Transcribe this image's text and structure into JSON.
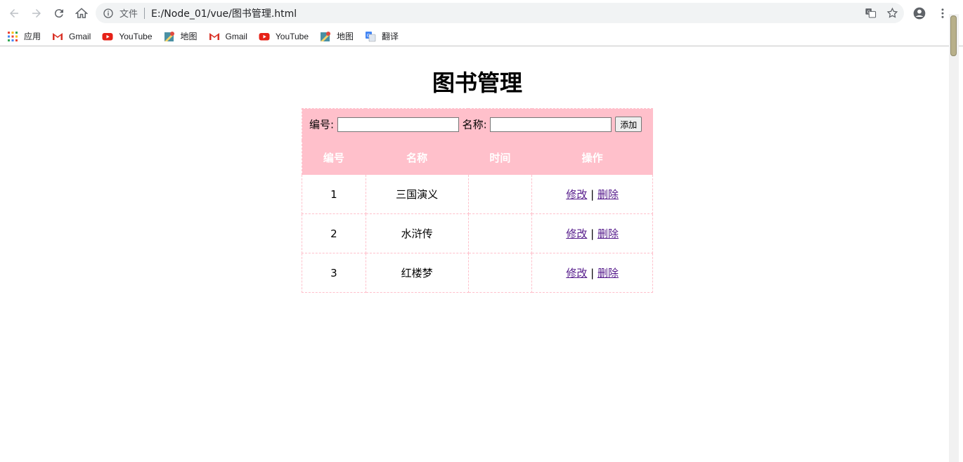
{
  "browser": {
    "scheme_label": "文件",
    "url": "E:/Node_01/vue/图书管理.html",
    "bookmarks": [
      {
        "label": "应用",
        "icon": "apps-grid-icon"
      },
      {
        "label": "Gmail",
        "icon": "gmail-icon"
      },
      {
        "label": "YouTube",
        "icon": "youtube-icon"
      },
      {
        "label": "地图",
        "icon": "maps-icon"
      },
      {
        "label": "Gmail",
        "icon": "gmail-icon"
      },
      {
        "label": "YouTube",
        "icon": "youtube-icon"
      },
      {
        "label": "地图",
        "icon": "maps-icon"
      },
      {
        "label": "翻译",
        "icon": "translate-icon"
      }
    ]
  },
  "page": {
    "title": "图书管理",
    "form": {
      "id_label": "编号:",
      "id_value": "",
      "name_label": "名称:",
      "name_value": "",
      "add_button": "添加"
    },
    "table": {
      "headers": [
        "编号",
        "名称",
        "时间",
        "操作"
      ],
      "rows": [
        {
          "id": "1",
          "name": "三国演义",
          "time": "",
          "edit": "修改",
          "sep": "|",
          "delete": "删除"
        },
        {
          "id": "2",
          "name": "水浒传",
          "time": "",
          "edit": "修改",
          "sep": "|",
          "delete": "删除"
        },
        {
          "id": "3",
          "name": "红楼梦",
          "time": "",
          "edit": "修改",
          "sep": "|",
          "delete": "删除"
        }
      ]
    }
  },
  "colors": {
    "table_accent": "#ffc0cb",
    "link_visited": "#551a8b"
  }
}
